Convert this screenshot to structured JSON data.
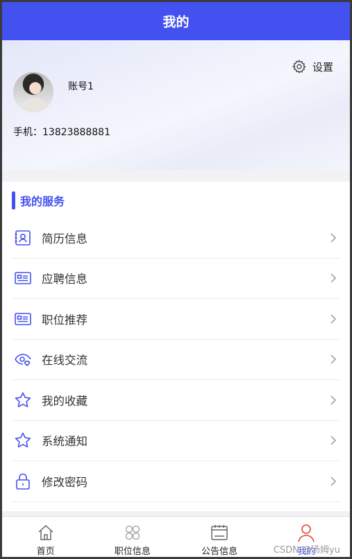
{
  "header": {
    "title": "我的"
  },
  "profile": {
    "settings_label": "设置",
    "account_name": "账号1",
    "phone_label": "手机：",
    "phone_number": "13823888881"
  },
  "services": {
    "title": "我的服务",
    "items": [
      {
        "label": "简历信息",
        "icon": "resume-icon"
      },
      {
        "label": "应聘信息",
        "icon": "id-card-icon"
      },
      {
        "label": "职位推荐",
        "icon": "id-card-icon"
      },
      {
        "label": "在线交流",
        "icon": "eye-heart-icon"
      },
      {
        "label": "我的收藏",
        "icon": "star-icon"
      },
      {
        "label": "系统通知",
        "icon": "star-icon"
      },
      {
        "label": "修改密码",
        "icon": "lock-icon"
      }
    ]
  },
  "tabbar": {
    "tabs": [
      {
        "label": "首页",
        "icon": "home-icon"
      },
      {
        "label": "职位信息",
        "icon": "grid-icon"
      },
      {
        "label": "公告信息",
        "icon": "calendar-icon"
      },
      {
        "label": "我的",
        "icon": "user-icon",
        "active": true
      }
    ]
  },
  "watermark": "CSDN @汤姆yu",
  "colors": {
    "brand": "#4351f0",
    "active_tab_icon": "#e0452f"
  }
}
